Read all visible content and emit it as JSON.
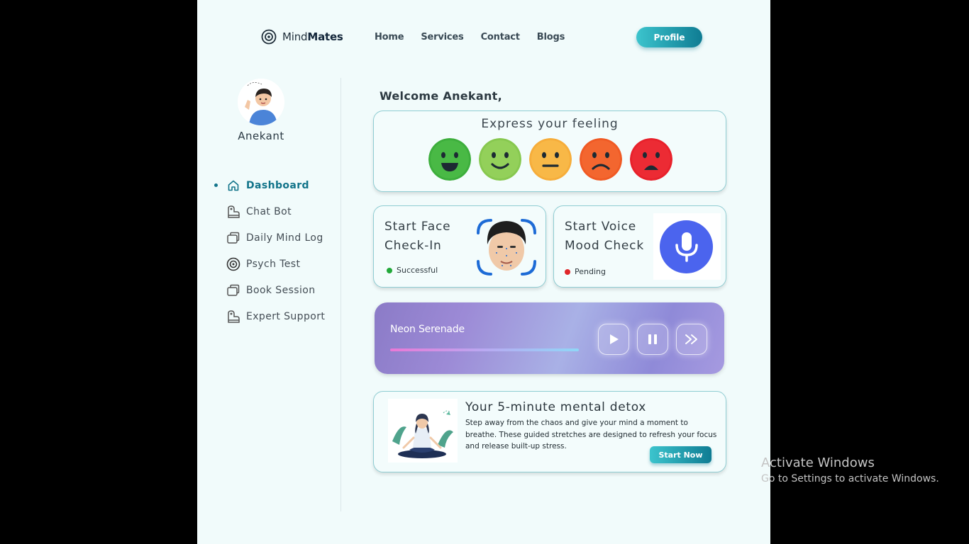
{
  "brand": {
    "prefix": "Mind",
    "bold": "Mates"
  },
  "nav": {
    "items": [
      "Home",
      "Services",
      "Contact",
      "Blogs"
    ],
    "profile_label": "Profile"
  },
  "user": {
    "name": "Anekant"
  },
  "sidebar": {
    "items": [
      {
        "label": "Dashboard",
        "icon": "home-icon",
        "active": true
      },
      {
        "label": "Chat Bot",
        "icon": "chat-bot-icon",
        "active": false
      },
      {
        "label": "Daily Mind Log",
        "icon": "log-icon",
        "active": false
      },
      {
        "label": "Psych Test",
        "icon": "target-icon",
        "active": false
      },
      {
        "label": "Book Session",
        "icon": "book-icon",
        "active": false
      },
      {
        "label": "Expert Support",
        "icon": "support-icon",
        "active": false
      }
    ]
  },
  "main": {
    "welcome": "Welcome Anekant,",
    "feeling": {
      "title": "Express your feeling",
      "emojis": [
        {
          "name": "very-happy-emoji",
          "color": "#3dae3c"
        },
        {
          "name": "happy-emoji",
          "color": "#87c84f"
        },
        {
          "name": "neutral-emoji",
          "color": "#f6ad3a"
        },
        {
          "name": "sad-emoji",
          "color": "#f05a24"
        },
        {
          "name": "very-sad-emoji",
          "color": "#e8212b"
        }
      ]
    },
    "face_checkin": {
      "title": "Start Face Check-In",
      "status": "Successful",
      "status_color": "#23a93a"
    },
    "voice_check": {
      "title": "Start Voice Mood Check",
      "status": "Pending",
      "status_color": "#e0262a"
    },
    "music": {
      "song": "Neon Serenade"
    },
    "detox": {
      "title": "Your 5-minute mental detox",
      "text": "Step away from the chaos and give your mind a moment to breathe. These guided stretches are designed to refresh your focus and release built-up stress.",
      "button": "Start Now"
    }
  },
  "watermark": {
    "line1": "Activate Windows",
    "line2": "Go to Settings to activate Windows."
  }
}
